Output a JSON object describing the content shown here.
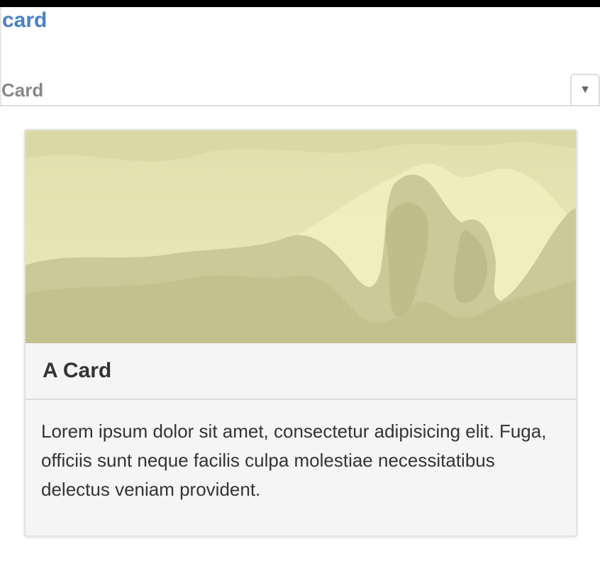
{
  "page": {
    "link_label": "card"
  },
  "section": {
    "title": "Card",
    "toggle_icon": "triangle-down"
  },
  "card": {
    "image_alt": "painted mountain landscape",
    "title": "A Card",
    "body": "Lorem ipsum dolor sit amet, consectetur adipisicing elit. Fuga, officiis sunt neque facilis culpa molestiae necessitatibus delectus veniam provident."
  },
  "colors": {
    "link": "#4a7fc6",
    "section_title": "#888888",
    "card_background": "#f5f5f6",
    "image_tint": "#d9d6a2"
  }
}
